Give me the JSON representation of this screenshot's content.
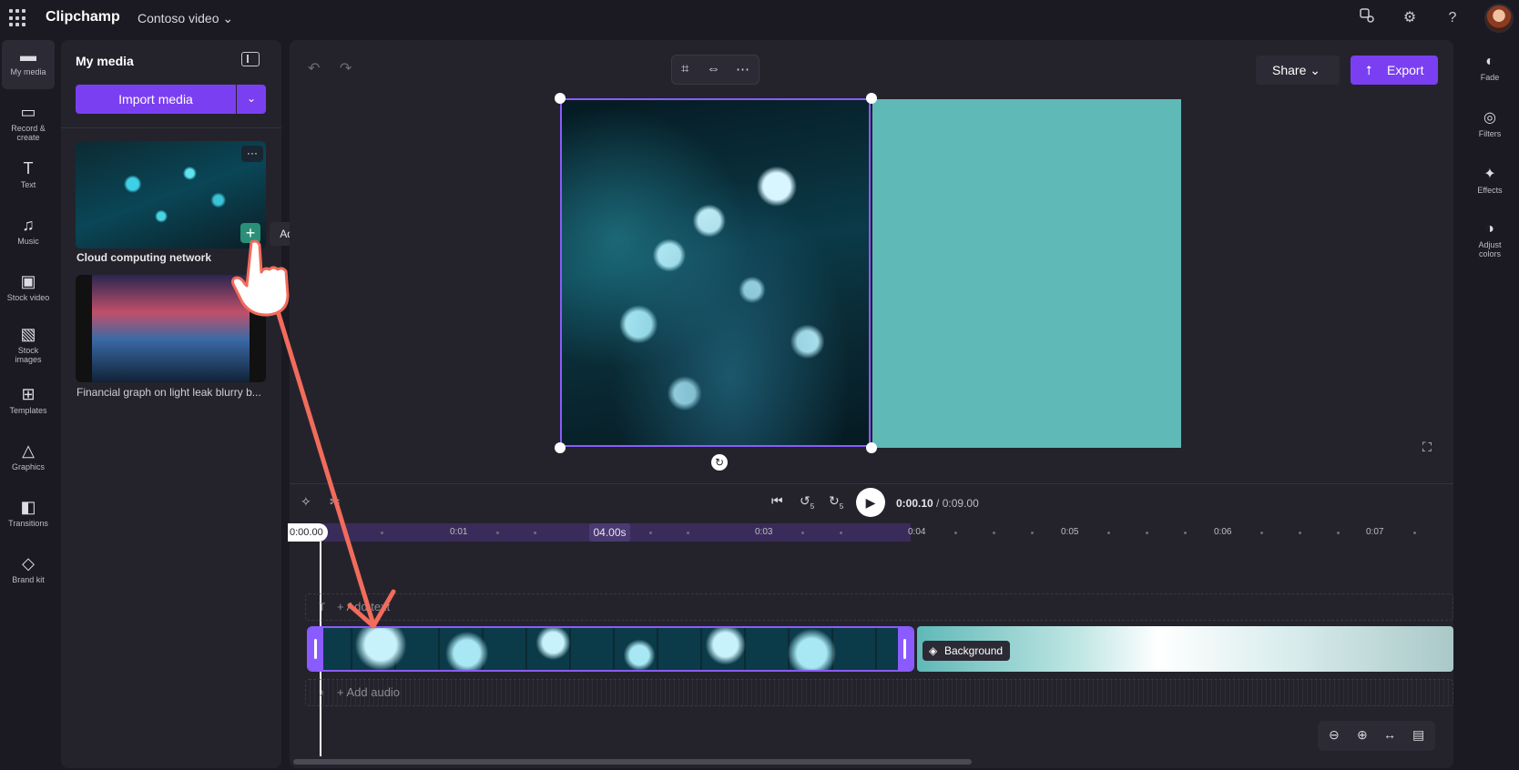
{
  "app": {
    "name": "Clipchamp",
    "project": "Contoso video"
  },
  "topbar": {
    "icons": [
      "apps-icon",
      "feedback-icon",
      "gear-icon",
      "help-icon"
    ],
    "help_glyph": "?"
  },
  "leftnav": {
    "items": [
      {
        "label": "My media"
      },
      {
        "label": "Record &",
        "label2": "create"
      },
      {
        "label": "Text"
      },
      {
        "label": "Music"
      },
      {
        "label": "Stock video"
      },
      {
        "label": "Stock",
        "label2": "images"
      },
      {
        "label": "Templates"
      },
      {
        "label": "Graphics"
      },
      {
        "label": "Transitions"
      },
      {
        "label": "Brand kit"
      }
    ]
  },
  "media_panel": {
    "title": "My media",
    "import_label": "Import media",
    "items": [
      {
        "name": "Cloud computing network"
      },
      {
        "name": "Financial graph on light leak blurry b..."
      }
    ],
    "more_glyph": "···",
    "add_glyph": "+",
    "tooltip": "Add to timeline"
  },
  "editor": {
    "share_label": "Share",
    "export_label": "Export",
    "context_icons": [
      "crop-icon",
      "fit-icon",
      "more-icon"
    ]
  },
  "playback": {
    "current": "0:00.10",
    "total": "/ 0:09.00",
    "skip_back": "5",
    "skip_fwd": "5"
  },
  "timeline": {
    "cursor_label": "0:00.00",
    "selection_label": "04.00s",
    "ticks": [
      "0:01",
      "0:03",
      "0:04",
      "0:05",
      "0:06",
      "0:07"
    ],
    "add_text": "+ Add text",
    "add_audio": "+ Add audio",
    "background_label": "Background"
  },
  "rightnav": {
    "items": [
      {
        "label": "Fade"
      },
      {
        "label": "Filters"
      },
      {
        "label": "Effects"
      },
      {
        "label": "Adjust",
        "label2": "colors"
      }
    ]
  },
  "colors": {
    "accent": "#7b3ff2",
    "selection": "#8a5cff",
    "background_fill": "#5fb9b7",
    "add_button": "#2a8f78",
    "annotation_arrow": "#f26b5b"
  }
}
